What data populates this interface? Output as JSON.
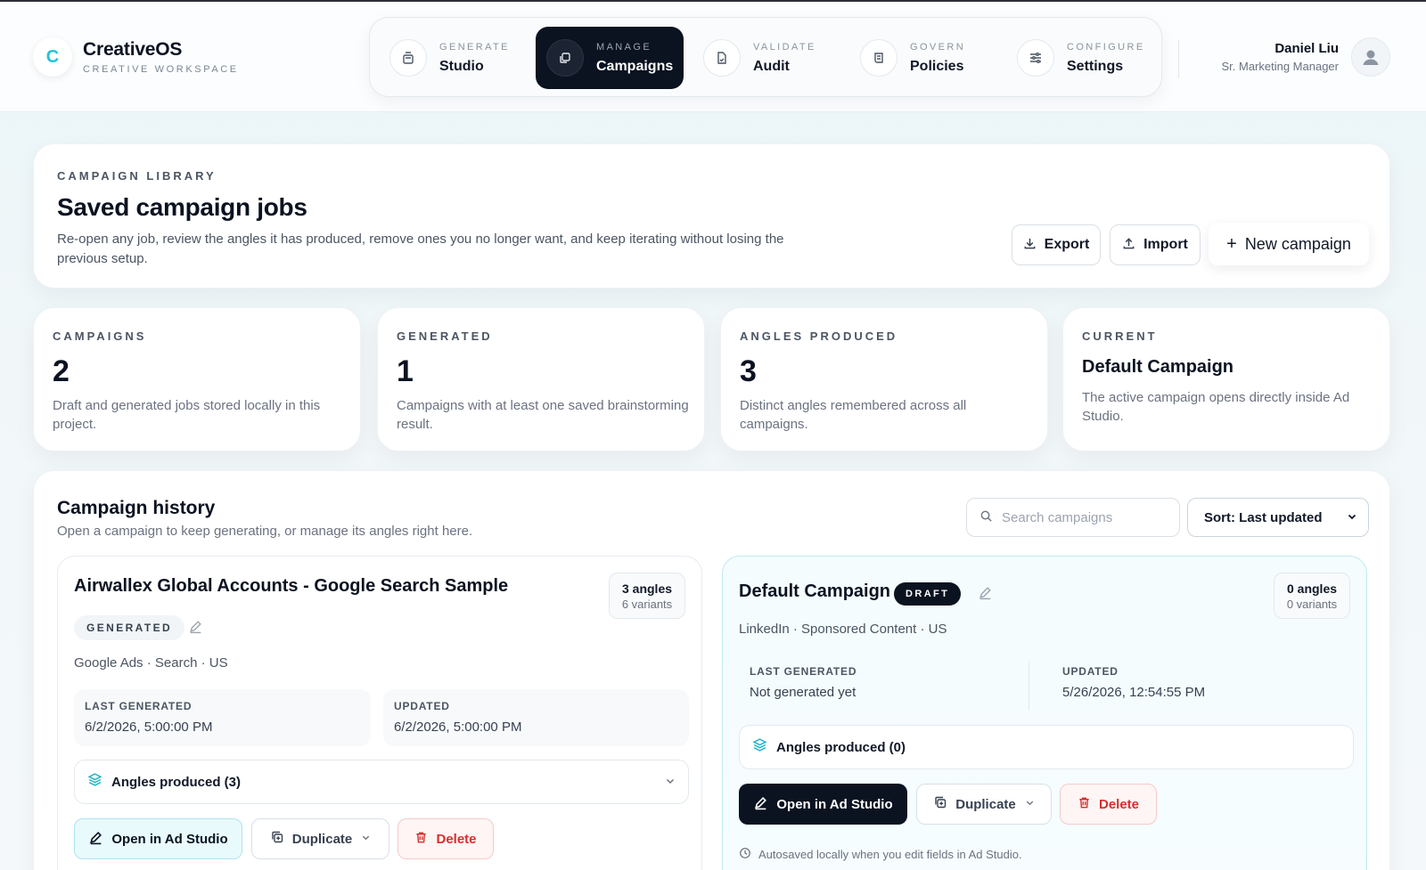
{
  "brand": {
    "logo": "C",
    "name": "CreativeOS",
    "tagline": "CREATIVE WORKSPACE"
  },
  "nav": [
    {
      "kicker": "GENERATE",
      "label": "Studio",
      "icon": "beaker-icon",
      "active": false
    },
    {
      "kicker": "MANAGE",
      "label": "Campaigns",
      "icon": "layers-icon",
      "active": true
    },
    {
      "kicker": "VALIDATE",
      "label": "Audit",
      "icon": "file-check-icon",
      "active": false
    },
    {
      "kicker": "GOVERN",
      "label": "Policies",
      "icon": "scroll-icon",
      "active": false
    },
    {
      "kicker": "CONFIGURE",
      "label": "Settings",
      "icon": "sliders-icon",
      "active": false
    }
  ],
  "user": {
    "name": "Daniel Liu",
    "role": "Sr. Marketing Manager"
  },
  "library": {
    "eyebrow": "CAMPAIGN LIBRARY",
    "title": "Saved campaign jobs",
    "description": "Re-open any job, review the angles it has produced, remove ones you no longer want, and keep iterating without losing the previous setup.",
    "export_label": "Export",
    "import_label": "Import",
    "new_label": "New campaign"
  },
  "stats": [
    {
      "eyebrow": "CAMPAIGNS",
      "value": "2",
      "description": "Draft and generated jobs stored locally in this project."
    },
    {
      "eyebrow": "GENERATED",
      "value": "1",
      "description": "Campaigns with at least one saved brainstorming result."
    },
    {
      "eyebrow": "ANGLES PRODUCED",
      "value": "3",
      "description": "Distinct angles remembered across all campaigns."
    },
    {
      "eyebrow": "CURRENT",
      "title": "Default Campaign",
      "description": "The active campaign opens directly inside Ad Studio."
    }
  ],
  "history": {
    "title": "Campaign history",
    "subtitle": "Open a campaign to keep generating, or manage its angles right here.",
    "search_placeholder": "Search campaigns",
    "sort_label": "Sort: Last updated"
  },
  "campaigns": [
    {
      "title": "Airwallex Global Accounts - Google Search Sample",
      "angles": "3 angles",
      "variants": "6 variants",
      "status": "GENERATED",
      "meta": "Google Ads · Search · US",
      "last_generated_label": "LAST GENERATED",
      "last_generated": "6/2/2026, 5:00:00 PM",
      "updated_label": "UPDATED",
      "updated": "6/2/2026, 5:00:00 PM",
      "angles_produced": "Angles produced (3)",
      "open_label": "Open in Ad Studio",
      "duplicate_label": "Duplicate",
      "delete_label": "Delete"
    },
    {
      "title": "Default Campaign",
      "badge": "DRAFT",
      "angles": "0 angles",
      "variants": "0 variants",
      "meta": "LinkedIn · Sponsored Content · US",
      "last_generated_label": "LAST GENERATED",
      "last_generated": "Not generated yet",
      "updated_label": "UPDATED",
      "updated": "5/26/2026, 12:54:55 PM",
      "angles_produced": "Angles produced (0)",
      "open_label": "Open in Ad Studio",
      "duplicate_label": "Duplicate",
      "delete_label": "Delete",
      "autosave": "Autosaved locally when you edit fields in Ad Studio."
    }
  ]
}
